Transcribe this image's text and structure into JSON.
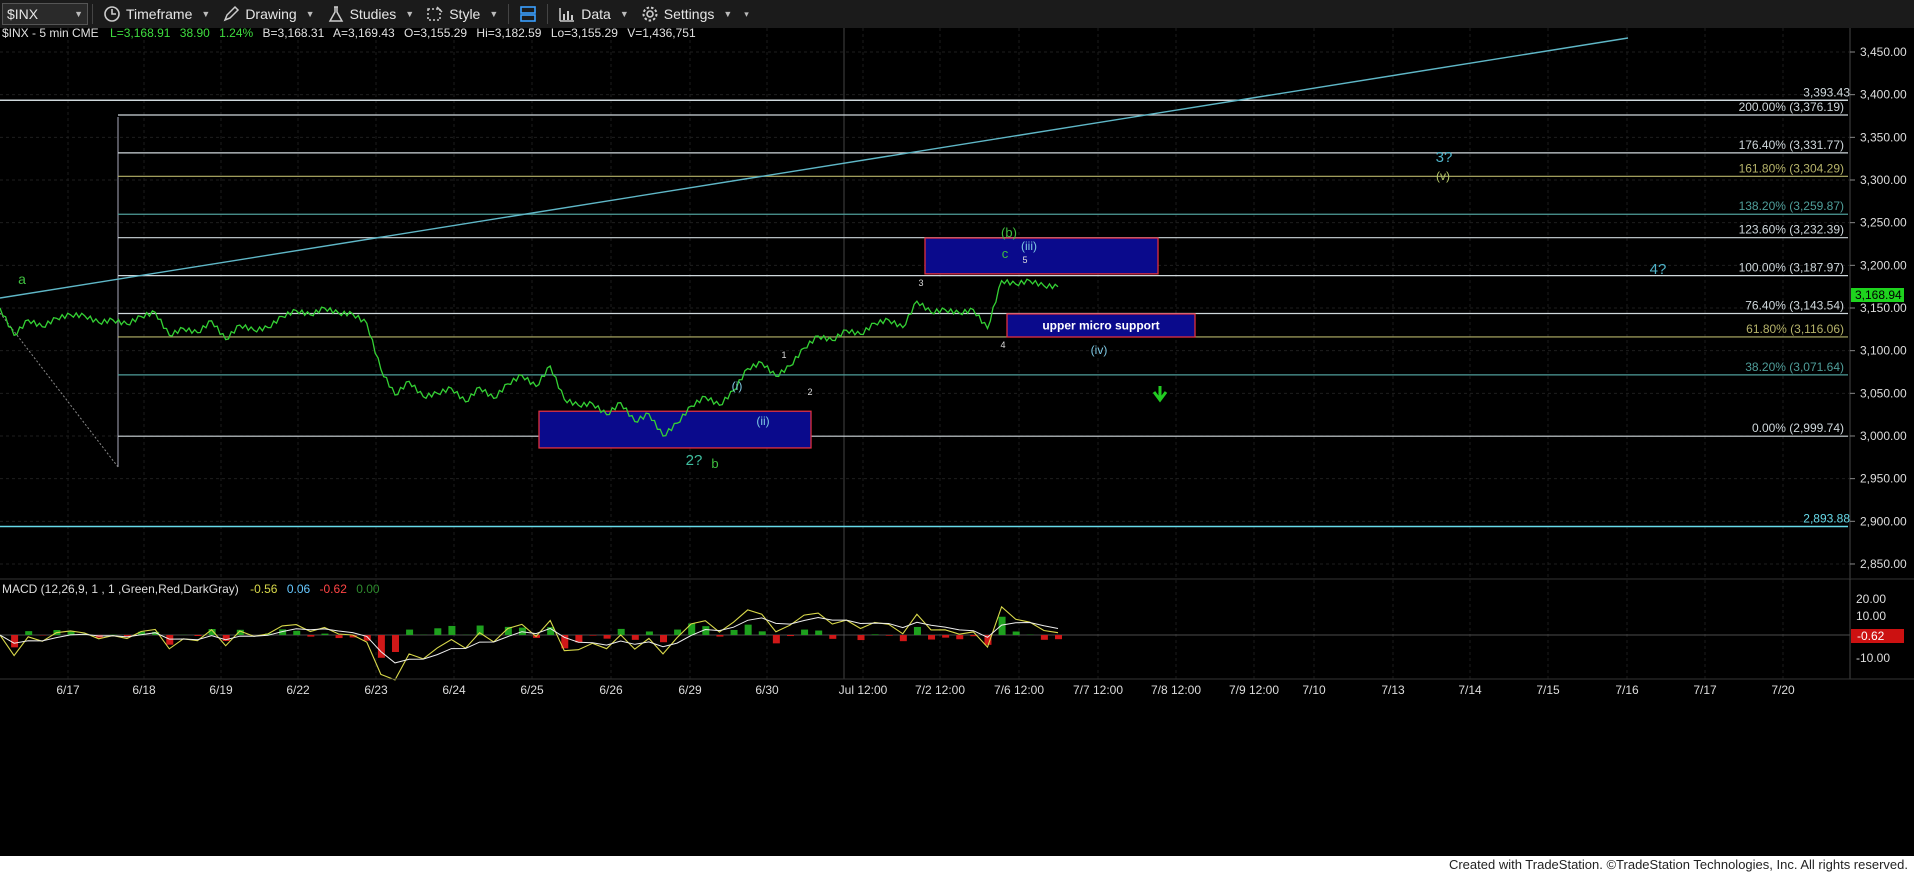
{
  "toolbar": {
    "symbol": "$INX",
    "timeframe": "Timeframe",
    "drawing": "Drawing",
    "studies": "Studies",
    "style": "Style",
    "data": "Data",
    "settings": "Settings"
  },
  "header": {
    "name": "$INX - 5 min  CME",
    "last": "L=3,168.91",
    "chg": "38.90",
    "pct": "1.24%",
    "bid": "B=3,168.31",
    "ask": "A=3,169.43",
    "open": "O=3,155.29",
    "high": "Hi=3,182.59",
    "low": "Lo=3,155.29",
    "vol": "V=1,436,751"
  },
  "macd": {
    "label": "MACD (12,26,9, 1 , 1 ,Green,Red,DarkGray)",
    "v1": "-0.56",
    "v2": "0.06",
    "v3": "-0.62",
    "v4": "0.00",
    "badge": "-0.62",
    "axis": [
      "20.00",
      "10.00",
      "-10.00"
    ]
  },
  "footer": "Created with TradeStation. ©TradeStation Technologies, Inc. All rights reserved.",
  "chart_data": {
    "type": "line",
    "title": "$INX - 5 min",
    "price_axis": {
      "ylim": [
        2825,
        3475
      ],
      "ticks": [
        "3,450.00",
        "3,400.00",
        "3,350.00",
        "3,300.00",
        "3,250.00",
        "3,200.00",
        "3,150.00",
        "3,100.00",
        "3,050.00",
        "3,000.00",
        "2,950.00",
        "2,900.00",
        "2,850.00"
      ]
    },
    "last_price": "3,168.94",
    "x_labels": [
      "6/17",
      "6/18",
      "6/19",
      "6/22",
      "6/23",
      "6/24",
      "6/25",
      "6/26",
      "6/29",
      "6/30",
      "Jul 12:00",
      "7/2 12:00",
      "7/6 12:00",
      "7/7 12:00",
      "7/8 12:00",
      "7/9 12:00",
      "7/10",
      "7/13",
      "7/14",
      "7/15",
      "7/16",
      "7/17",
      "7/20"
    ],
    "fib_levels": [
      {
        "label": "200.00% (3,376.19)",
        "value": 3376.19,
        "color": "#cfd8dc"
      },
      {
        "label": "176.40% (3,331.77)",
        "value": 3331.77,
        "color": "#cfd8dc"
      },
      {
        "label": "161.80% (3,304.29)",
        "value": 3304.29,
        "color": "#b6b36a"
      },
      {
        "label": "138.20% (3,259.87)",
        "value": 3259.87,
        "color": "#4f9e9a"
      },
      {
        "label": "123.60% (3,232.39)",
        "value": 3232.39,
        "color": "#cfd8dc"
      },
      {
        "label": "100.00% (3,187.97)",
        "value": 3187.97,
        "color": "#cfd8dc"
      },
      {
        "label": "76.40% (3,143.54)",
        "value": 3143.54,
        "color": "#cfd8dc"
      },
      {
        "label": "61.80% (3,116.06)",
        "value": 3116.06,
        "color": "#b6b36a"
      },
      {
        "label": "38.20% (3,071.64)",
        "value": 3071.64,
        "color": "#4f9e9a"
      },
      {
        "label": "0.00% (2,999.74)",
        "value": 2999.74,
        "color": "#cfd8dc"
      }
    ],
    "h_lines": [
      {
        "label": "3,393.43",
        "value": 3393.43,
        "color": "#cfd8dc"
      },
      {
        "label": "2,893.88",
        "value": 2893.88,
        "color": "#66d9e8"
      }
    ],
    "zones": [
      {
        "label": "",
        "top": 3029,
        "bottom": 2986
      },
      {
        "label": "",
        "top": 3232,
        "bottom": 3190
      },
      {
        "label": "upper micro support",
        "top": 3143,
        "bottom": 3116
      }
    ],
    "wave_labels": [
      {
        "text": "a",
        "color": "#3fbf3f"
      },
      {
        "text": "2?",
        "color": "#3fbf9f"
      },
      {
        "text": "b",
        "color": "#3fbf3f"
      },
      {
        "text": "(i)",
        "color": "#7ec8e3"
      },
      {
        "text": "(ii)",
        "color": "#7ec8e3"
      },
      {
        "text": "1",
        "color": "#dddddd"
      },
      {
        "text": "2",
        "color": "#dddddd"
      },
      {
        "text": "3",
        "color": "#dddddd"
      },
      {
        "text": "4",
        "color": "#dddddd"
      },
      {
        "text": "5",
        "color": "#dddddd"
      },
      {
        "text": "(b)",
        "color": "#3fbf3f"
      },
      {
        "text": "c",
        "color": "#3fbf3f"
      },
      {
        "text": "(iii)",
        "color": "#7ec8e3"
      },
      {
        "text": "(iv)",
        "color": "#7ec8e3"
      },
      {
        "text": "3?",
        "color": "#4fb3c9"
      },
      {
        "text": "(v)",
        "color": "#b6c96a"
      },
      {
        "text": "4?",
        "color": "#4fb3c9"
      }
    ],
    "price_path": [
      3150,
      3118,
      3136,
      3128,
      3138,
      3142,
      3141,
      3133,
      3136,
      3131,
      3140,
      3145,
      3118,
      3126,
      3121,
      3135,
      3113,
      3130,
      3124,
      3127,
      3140,
      3147,
      3142,
      3150,
      3144,
      3143,
      3132,
      3078,
      3048,
      3064,
      3046,
      3050,
      3056,
      3040,
      3057,
      3044,
      3061,
      3071,
      3058,
      3082,
      3043,
      3036,
      3038,
      3025,
      3039,
      3017,
      3026,
      3000,
      3015,
      3035,
      3046,
      3036,
      3053,
      3079,
      3086,
      3070,
      3082,
      3103,
      3117,
      3112,
      3124,
      3119,
      3132,
      3136,
      3127,
      3158,
      3145,
      3148,
      3144,
      3148,
      3126,
      3182,
      3178,
      3182,
      3176,
      3175
    ]
  }
}
